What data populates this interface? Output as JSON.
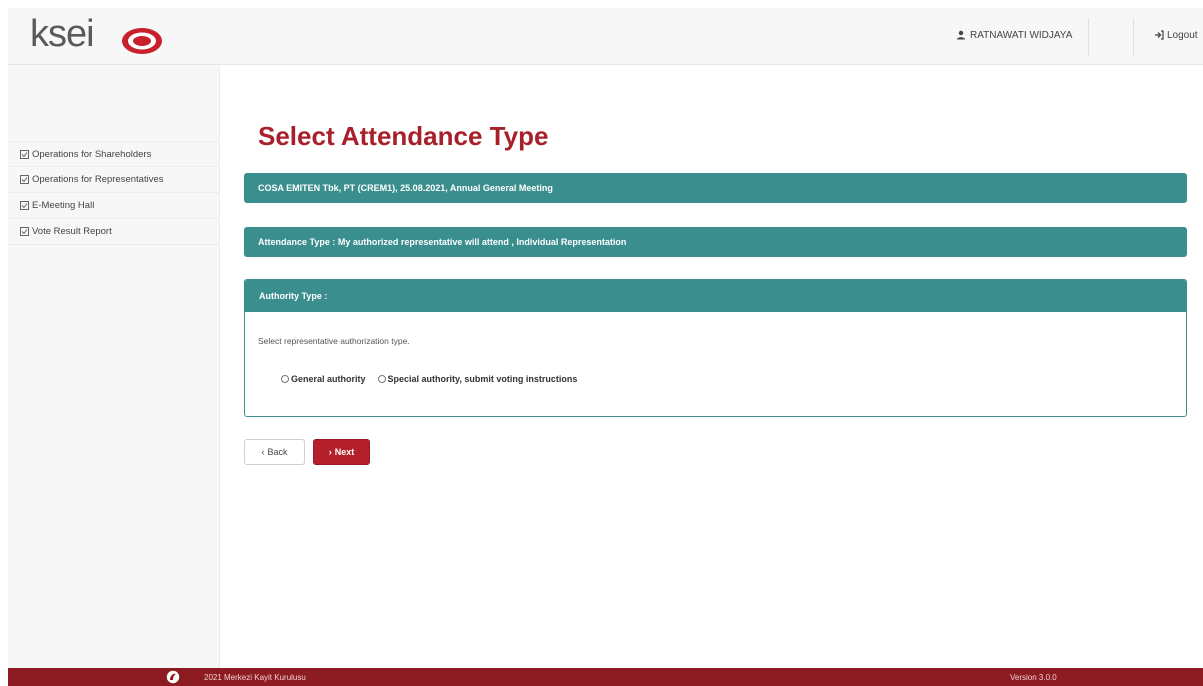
{
  "header": {
    "logo_text": "ksei",
    "logo_tagline": "",
    "user_name": "RATNAWATI WIDJAYA",
    "logout_label": "Logout"
  },
  "sidebar": {
    "items": [
      {
        "label": "Operations for Shareholders"
      },
      {
        "label": "Operations for Representatives"
      },
      {
        "label": "E-Meeting Hall"
      },
      {
        "label": "Vote Result Report"
      }
    ]
  },
  "main": {
    "title": "Select Attendance Type",
    "meeting_bar": "COSA EMITEN Tbk, PT (CREM1), 25.08.2021, Annual General Meeting",
    "attendance_bar": "Attendance Type : My authorized representative will attend , Individual Representation",
    "authority_panel": {
      "heading": "Authority Type :",
      "prompt": "Select representative authorization type.",
      "options": [
        {
          "label": "General authority",
          "selected": false
        },
        {
          "label": "Special authority, submit voting instructions",
          "selected": false
        }
      ]
    },
    "back_label": "Back",
    "next_label": "Next"
  },
  "footer": {
    "copyright": "2021 Merkezi Kayit Kurulusu",
    "version": "Version 3.0.0"
  },
  "colors": {
    "brand_red": "#a8202b",
    "teal": "#3a8f8e",
    "footer_red": "#8d1b22"
  }
}
